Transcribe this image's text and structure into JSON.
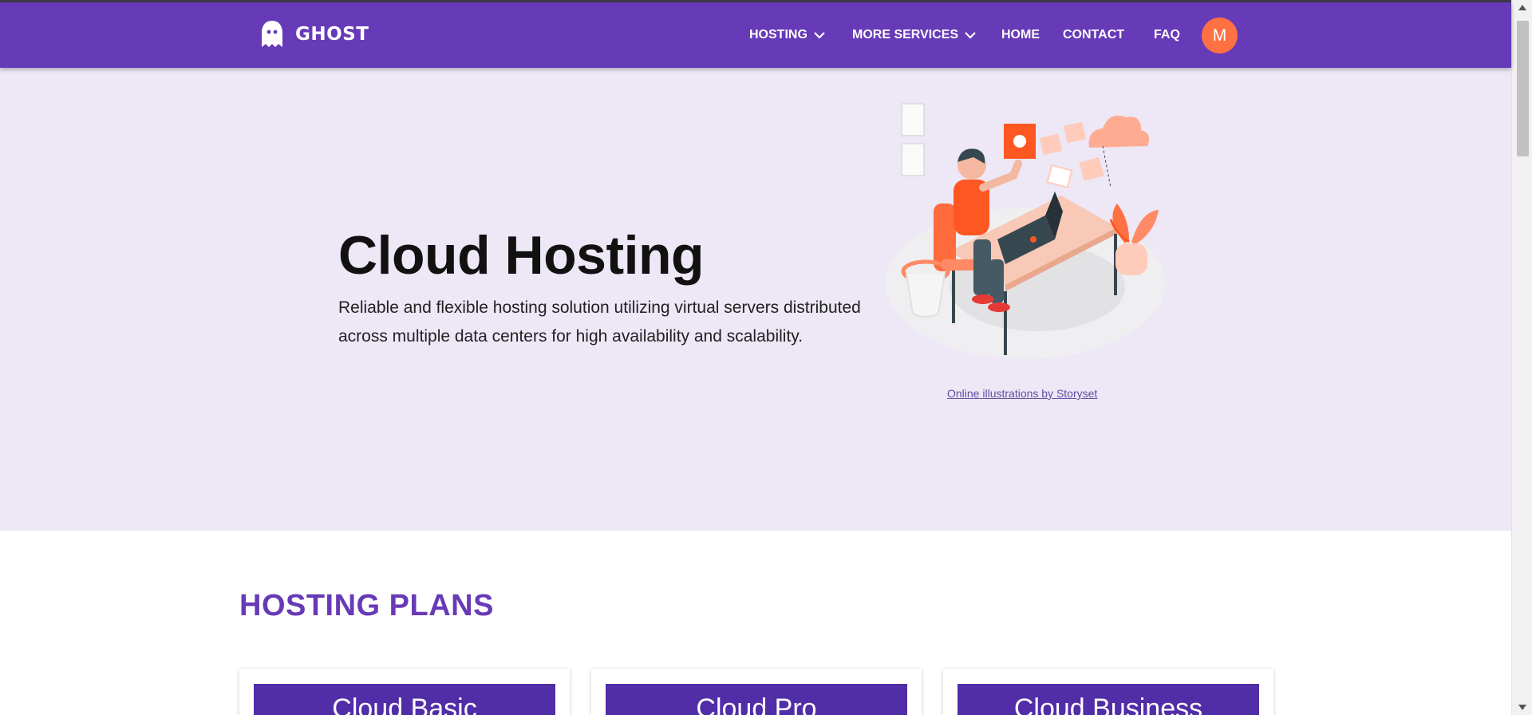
{
  "brand": {
    "name": "GHOST",
    "icon": "ghost-icon"
  },
  "nav": {
    "items": [
      {
        "label": "HOSTING",
        "dropdown": true
      },
      {
        "label": "MORE SERVICES",
        "dropdown": true
      },
      {
        "label": "HOME",
        "dropdown": false
      },
      {
        "label": "CONTACT",
        "dropdown": false
      },
      {
        "label": "FAQ",
        "dropdown": false
      }
    ],
    "avatar_initial": "M"
  },
  "hero": {
    "title": "Cloud Hosting",
    "description": "Reliable and flexible hosting solution utilizing virtual servers distributed across multiple data centers for high availability and scalability.",
    "illustration_credit": "Online illustrations by Storyset"
  },
  "plans": {
    "title": "HOSTING PLANS",
    "cards": [
      {
        "name": "Cloud Basic"
      },
      {
        "name": "Cloud Pro"
      },
      {
        "name": "Cloud Business"
      }
    ]
  },
  "colors": {
    "primary": "#673ab7",
    "primary_dark": "#512da8",
    "accent": "#ff7043",
    "hero_bg": "#ede7f6"
  }
}
